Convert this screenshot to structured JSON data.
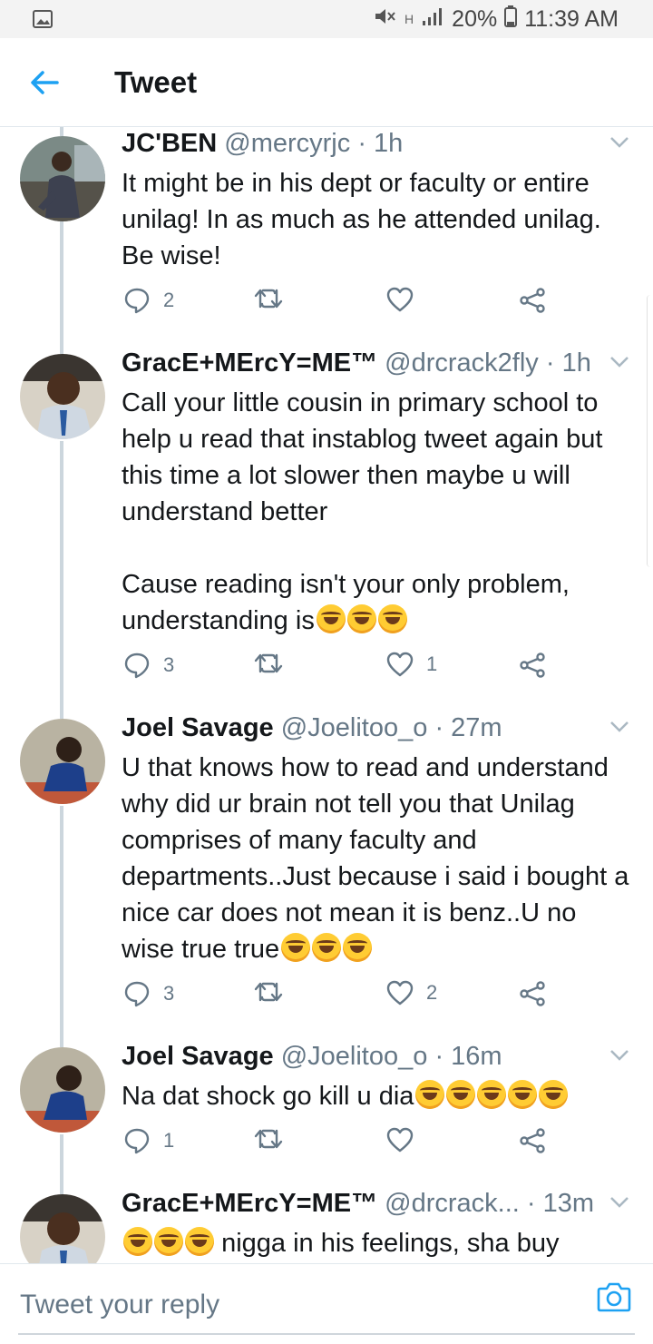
{
  "status_bar": {
    "battery": "20%",
    "time": "11:39 AM",
    "network": "H"
  },
  "header": {
    "title": "Tweet"
  },
  "tweets": [
    {
      "name": "JC'BEN",
      "handle": "@mercyrjc",
      "sep": "·",
      "time": "1h",
      "text": "It might be in his dept or faculty or entire unilag! In as much as he attended unilag. Be wise!",
      "emoji": [],
      "replies": "2",
      "retweets": "",
      "likes": ""
    },
    {
      "name": "GracE+MErcY=ME™",
      "handle": "@drcrack2fly",
      "sep": "·",
      "time": "1h",
      "text": "Call your little cousin in primary school to help u read that instablog tweet again but this time a lot slower then maybe u will understand better\n\nCause reading isn't your only problem, understanding is",
      "emoji": [
        "rofl",
        "rofl",
        "rofl"
      ],
      "replies": "3",
      "retweets": "",
      "likes": "1"
    },
    {
      "name": "Joel Savage",
      "handle": "@Joelitoo_o",
      "sep": "·",
      "time": "27m",
      "text": "U that knows how to read and understand why did ur brain not tell you that Unilag comprises of many faculty and departments..Just because i said i bought a nice car does not mean it is benz..U no wise true true",
      "emoji": [
        "joy",
        "joy",
        "joy"
      ],
      "replies": "3",
      "retweets": "",
      "likes": "2"
    },
    {
      "name": "Joel Savage",
      "handle": "@Joelitoo_o",
      "sep": "·",
      "time": "16m",
      "text": "Na dat shock go kill u dia",
      "emoji": [
        "joy",
        "joy",
        "joy",
        "joy",
        "joy"
      ],
      "replies": "1",
      "retweets": "",
      "likes": ""
    },
    {
      "name": "GracE+MErcY=ME™",
      "handle": "@drcrack...",
      "sep": "·",
      "time": "13m",
      "text": "nigga in his feelings, sha buy",
      "emoji_prefix": [
        "rofl",
        "rofl",
        "rofl"
      ],
      "replies": "",
      "retweets": "",
      "likes": ""
    }
  ],
  "reply_bar": {
    "placeholder": "Tweet your reply"
  },
  "colors": {
    "accent": "#1da1f2",
    "icon": "#657786",
    "text": "#14171a",
    "line": "#ccd6dd"
  }
}
